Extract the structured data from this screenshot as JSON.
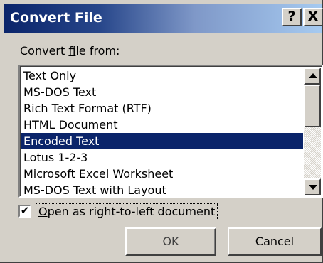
{
  "window": {
    "title": "Convert File",
    "help_label": "?",
    "close_label": "X"
  },
  "convert_from": {
    "label_prefix": "Convert ",
    "label_accel": "f",
    "label_suffix": "ile from:",
    "items": [
      "Text Only",
      "MS-DOS Text",
      "Rich Text Format (RTF)",
      "HTML Document",
      "Encoded Text",
      "Lotus 1-2-3",
      "Microsoft Excel Worksheet",
      "MS-DOS Text with Layout"
    ],
    "selected": "Encoded Text"
  },
  "rtl_option": {
    "checked": true,
    "check_glyph": "✔",
    "label_accel": "O",
    "label_rest": "pen as right-to-left document"
  },
  "buttons": {
    "ok_label": "OK",
    "cancel_label": "Cancel"
  }
}
